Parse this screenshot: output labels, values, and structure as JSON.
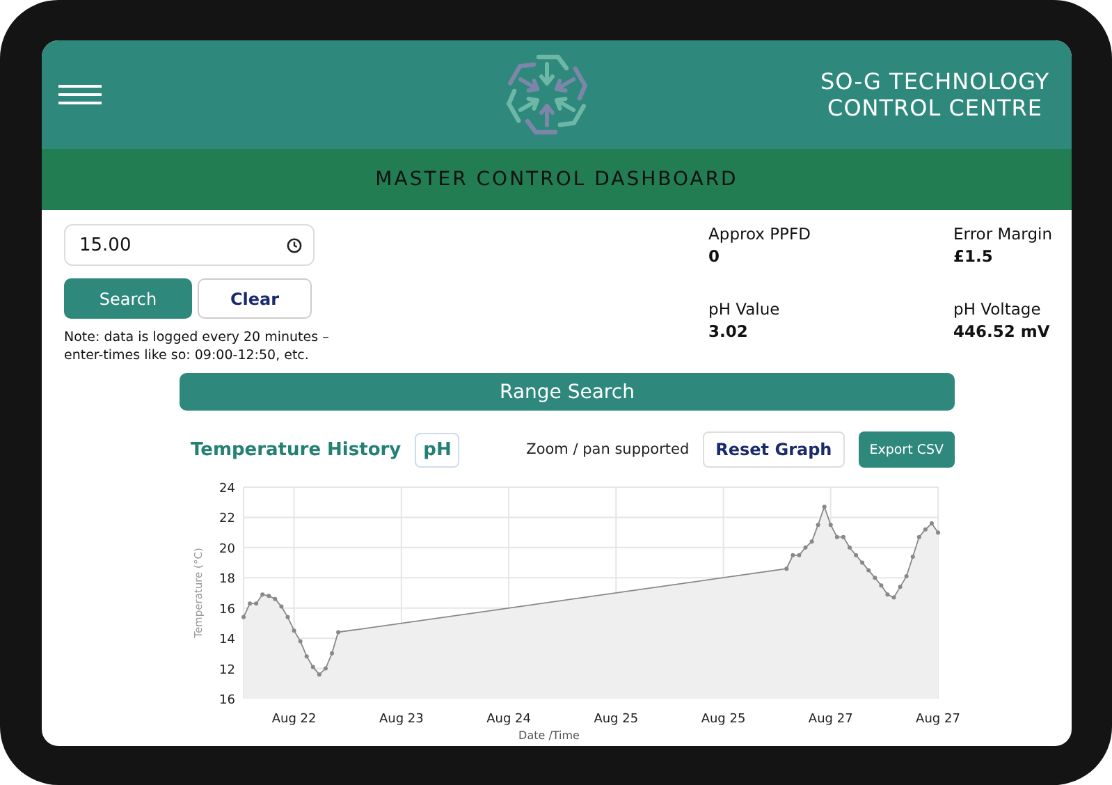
{
  "header": {
    "title_lines": [
      "SO-G TECHNOLOGY",
      "CONTROL CENTRE"
    ]
  },
  "banner": "MASTER CONTROL DASHBOARD",
  "time_field": {
    "value": "15.00"
  },
  "buttons": [
    {
      "label": "Search",
      "kind": "primary"
    },
    {
      "label": "Clear",
      "kind": "secondary"
    }
  ],
  "note": "Note: data is logged every 20 minutes – enter-times like so: 09:00-12:50, etc.",
  "readings": [
    {
      "label": "Approx PPFD",
      "value": "0"
    },
    {
      "label": "Error Margin",
      "value": "£1.5"
    },
    {
      "label": "pH Value",
      "value": "3.02"
    },
    {
      "label": "pH Voltage",
      "value": "446.52 mV"
    }
  ],
  "range_search": "Range Search",
  "chart_panel": {
    "title": "Temperature History",
    "toggle": "pH",
    "hint": "Zoom / pan supported",
    "actions": [
      {
        "label": "Reset Graph",
        "kind": "outline"
      },
      {
        "label": "Export CSV",
        "kind": "filled"
      }
    ],
    "axis_bottom_label": "16",
    "chart_data": {
      "type": "area",
      "grid": true,
      "xlabel": "Date /Time",
      "ylabel": "Temperature (°C)",
      "categories": [
        null,
        null,
        null,
        null,
        null,
        null,
        null,
        null,
        "Aug 22",
        null,
        null,
        null,
        null,
        null,
        null,
        null,
        null,
        null,
        null,
        null,
        null,
        null,
        null,
        null,
        null,
        "Aug 23",
        null,
        null,
        null,
        null,
        null,
        null,
        null,
        null,
        null,
        null,
        null,
        null,
        null,
        null,
        null,
        null,
        "Aug 24",
        null,
        null,
        null,
        null,
        null,
        null,
        null,
        null,
        null,
        null,
        null,
        null,
        null,
        null,
        null,
        null,
        "Aug 25",
        null,
        null,
        null,
        null,
        null,
        null,
        null,
        null,
        null,
        null,
        null,
        null,
        null,
        null,
        null,
        null,
        "Aug 25",
        null,
        null,
        null,
        null,
        null,
        null,
        null,
        null,
        null,
        null,
        null,
        null,
        null,
        null,
        null,
        null,
        "Aug 27",
        null,
        null,
        null,
        null,
        null,
        null,
        null,
        null,
        null,
        null,
        null,
        null,
        null,
        null,
        null,
        null,
        "Aug 27"
      ],
      "series": [
        {
          "color": "#888888",
          "values": [
            15.4,
            16.3,
            16.3,
            16.9,
            16.8,
            16.6,
            16.1,
            15.4,
            14.5,
            13.8,
            12.8,
            12.1,
            11.6,
            12.0,
            13.0,
            14.4,
            null,
            null,
            null,
            null,
            null,
            null,
            null,
            null,
            null,
            null,
            null,
            null,
            null,
            null,
            null,
            null,
            null,
            null,
            null,
            null,
            null,
            null,
            null,
            null,
            null,
            null,
            null,
            null,
            null,
            null,
            null,
            null,
            null,
            null,
            null,
            null,
            null,
            null,
            null,
            null,
            null,
            null,
            null,
            null,
            null,
            null,
            null,
            null,
            null,
            null,
            null,
            null,
            null,
            null,
            null,
            null,
            null,
            null,
            null,
            null,
            null,
            null,
            null,
            null,
            null,
            null,
            null,
            null,
            null,
            null,
            18.6,
            19.5,
            19.5,
            20.0,
            20.4,
            21.5,
            22.7,
            21.5,
            20.7,
            20.7,
            20.0,
            19.5,
            19.0,
            18.5,
            18.0,
            17.5,
            16.9,
            16.7,
            17.4,
            18.1,
            19.4,
            20.7,
            21.2,
            21.6,
            21.0
          ]
        }
      ],
      "ylim": [
        10,
        24
      ],
      "yticks": [
        12,
        14,
        16,
        18,
        20,
        22,
        24
      ]
    }
  }
}
